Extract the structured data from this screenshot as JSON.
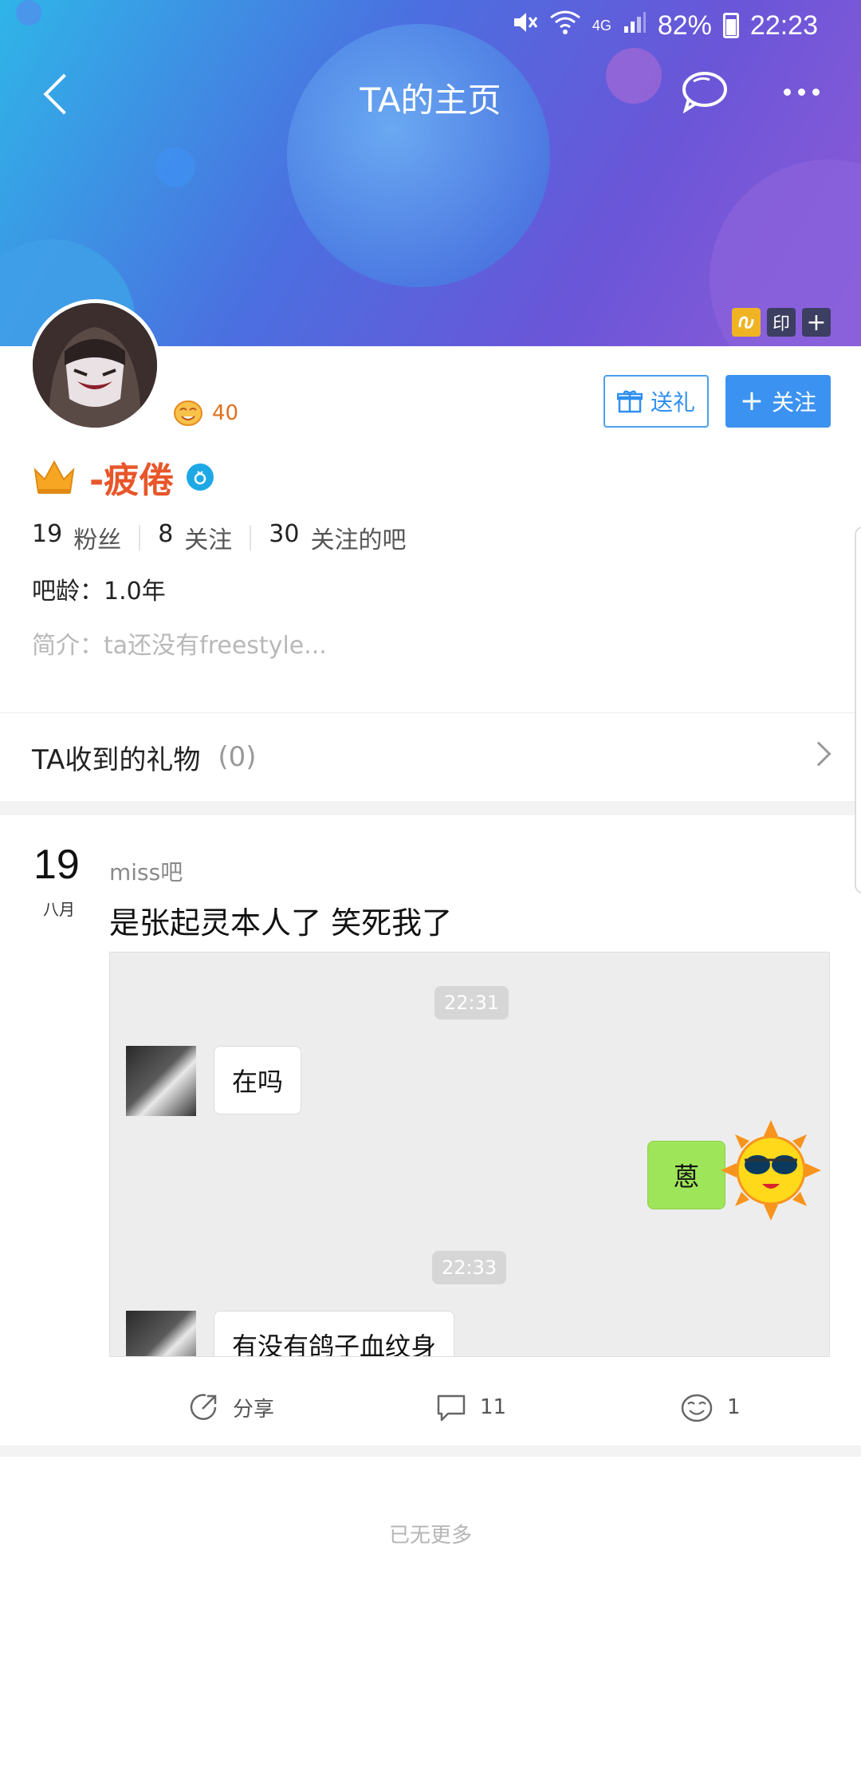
{
  "status_bar": {
    "battery": "82%",
    "time": "22:23",
    "network": "4G"
  },
  "header": {
    "title": "TA的主页",
    "badge_text": "印"
  },
  "profile": {
    "level": "40",
    "username": "-疲倦",
    "stats": [
      {
        "num": "19",
        "label": "粉丝"
      },
      {
        "num": "8",
        "label": "关注"
      },
      {
        "num": "30",
        "label": "关注的吧"
      }
    ],
    "age": "吧龄：1.0年",
    "bio": "简介：ta还没有freestyle..."
  },
  "buttons": {
    "gift": "送礼",
    "follow": "关注"
  },
  "gifts": {
    "label": "TA收到的礼物",
    "count": "(0)"
  },
  "post": {
    "day": "19",
    "month": "八月",
    "forum": "miss吧",
    "title": "是张起灵本人了 笑死我了",
    "screenshot": {
      "time1": "22:31",
      "msg1": "在吗",
      "reply": "蒽",
      "time2": "22:33",
      "msg2": "有没有鸽子血纹身"
    },
    "actions": {
      "share": "分享",
      "comments": "11",
      "likes": "1"
    }
  },
  "footer": {
    "no_more": "已无更多"
  },
  "colors": {
    "accent": "#3c92f0",
    "name": "#e8562a",
    "level": "#e0701d"
  }
}
